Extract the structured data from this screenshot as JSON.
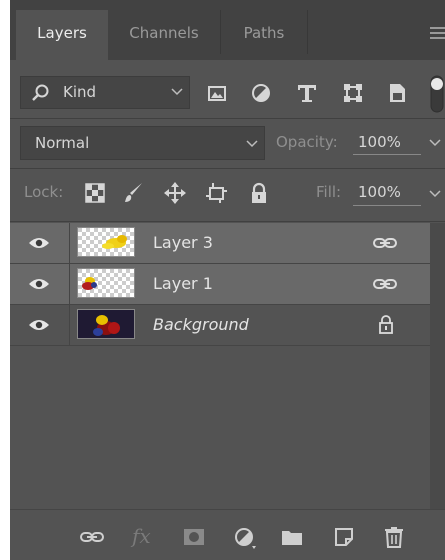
{
  "tabs": [
    {
      "label": "Layers",
      "active": true
    },
    {
      "label": "Channels",
      "active": false
    },
    {
      "label": "Paths",
      "active": false
    }
  ],
  "filter": {
    "kind_label": "Kind",
    "icons": [
      "image-filter-icon",
      "adjustment-filter-icon",
      "type-filter-icon",
      "shape-filter-icon",
      "smart-object-filter-icon"
    ]
  },
  "blend": {
    "mode": "Normal",
    "opacity_label": "Opacity:",
    "opacity_value": "100%"
  },
  "lock": {
    "label": "Lock:",
    "icons": [
      "lock-transparent-pixels-icon",
      "lock-image-pixels-icon",
      "lock-position-icon",
      "lock-artboard-icon",
      "lock-all-icon"
    ],
    "fill_label": "Fill:",
    "fill_value": "100%"
  },
  "layers": [
    {
      "name": "Layer 3",
      "visible": true,
      "selected": true,
      "linked": true,
      "locked": false,
      "italic": false
    },
    {
      "name": "Layer 1",
      "visible": true,
      "selected": true,
      "linked": true,
      "locked": false,
      "italic": false
    },
    {
      "name": "Background",
      "visible": true,
      "selected": false,
      "linked": false,
      "locked": true,
      "italic": true
    }
  ],
  "bottom_icons": [
    "link-layers-icon",
    "fx-icon",
    "add-mask-icon",
    "new-adjustment-layer-icon",
    "new-group-icon",
    "new-layer-icon",
    "delete-layer-icon"
  ],
  "bottom_fx_label": "fx",
  "colors": {
    "panel_bg": "#535353",
    "tabbar_bg": "#424242",
    "selected_row": "#696969",
    "text": "#d6d6d6"
  }
}
